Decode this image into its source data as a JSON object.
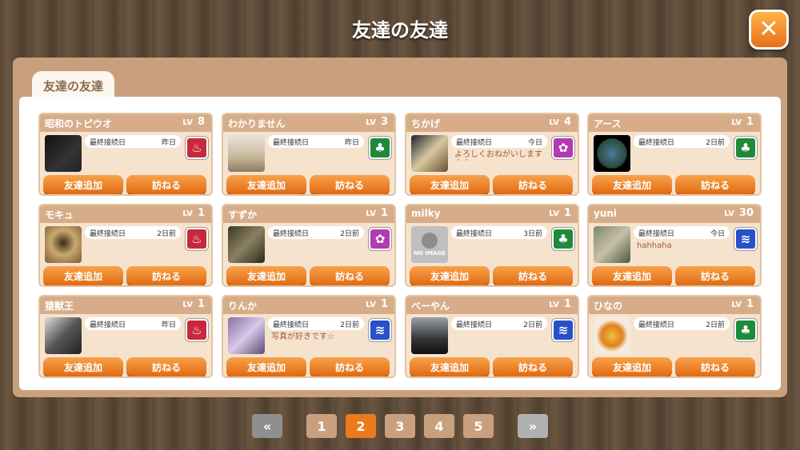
{
  "title": "友達の友達",
  "tab_label": "友達の友達",
  "close_symbol": "✕",
  "colors": {
    "accent": "#ea7a1c",
    "panel": "#c9a07e",
    "type_red": "#c8283c",
    "type_green": "#1f8a3a",
    "type_purple": "#b23ab2",
    "type_blue": "#2850c8"
  },
  "labels": {
    "lv": "LV",
    "last_login": "最終接続日",
    "add_friend": "友達追加",
    "visit": "訪ねる",
    "no_image": "NO IMAGE"
  },
  "friends": [
    {
      "name": "昭和のトピウオ",
      "level": "8",
      "last_login": "昨日",
      "comment": "",
      "type": "red",
      "type_icon": "flame-emblem-icon",
      "avatar": "photo-black-handwriting"
    },
    {
      "name": "わかりません",
      "level": "3",
      "last_login": "昨日",
      "comment": "",
      "type": "green",
      "type_icon": "tree-emblem-icon",
      "avatar": "photo-cakes"
    },
    {
      "name": "ちかげ",
      "level": "4",
      "last_login": "今日",
      "comment": "よろしくおねがいします＾＾",
      "type": "purple",
      "type_icon": "flower-emblem-icon",
      "avatar": "photo-cat"
    },
    {
      "name": "アース",
      "level": "1",
      "last_login": "2日前",
      "comment": "",
      "type": "green",
      "type_icon": "tree-emblem-icon",
      "avatar": "photo-earth"
    },
    {
      "name": "モキュ",
      "level": "1",
      "last_login": "2日前",
      "comment": "",
      "type": "red",
      "type_icon": "flame-emblem-icon",
      "avatar": "photo-monkey"
    },
    {
      "name": "すずか",
      "level": "1",
      "last_login": "2日前",
      "comment": "",
      "type": "purple",
      "type_icon": "flower-emblem-icon",
      "avatar": "photo-animal"
    },
    {
      "name": "milky",
      "level": "1",
      "last_login": "3日前",
      "comment": "",
      "type": "green",
      "type_icon": "tree-emblem-icon",
      "avatar": "no-image"
    },
    {
      "name": "yuni",
      "level": "30",
      "last_login": "今日",
      "comment": "hahhaha",
      "type": "blue",
      "type_icon": "water-emblem-icon",
      "avatar": "photo-figure"
    },
    {
      "name": "猿獣王",
      "level": "1",
      "last_login": "昨日",
      "comment": "",
      "type": "red",
      "type_icon": "flame-emblem-icon",
      "avatar": "photo-bw"
    },
    {
      "name": "りんか",
      "level": "1",
      "last_login": "2日前",
      "comment": "写真が好きです☆",
      "type": "blue",
      "type_icon": "water-emblem-icon",
      "avatar": "photo-room"
    },
    {
      "name": "べーやん",
      "level": "1",
      "last_login": "2日前",
      "comment": "",
      "type": "blue",
      "type_icon": "water-emblem-icon",
      "avatar": "photo-gorilla"
    },
    {
      "name": "ひなの",
      "level": "1",
      "last_login": "2日前",
      "comment": "",
      "type": "green",
      "type_icon": "tree-emblem-icon",
      "avatar": "photo-food"
    }
  ],
  "pagination": {
    "first_symbol": "«",
    "next_symbol": "»",
    "pages": [
      "1",
      "2",
      "3",
      "4",
      "5"
    ],
    "current": "2"
  }
}
